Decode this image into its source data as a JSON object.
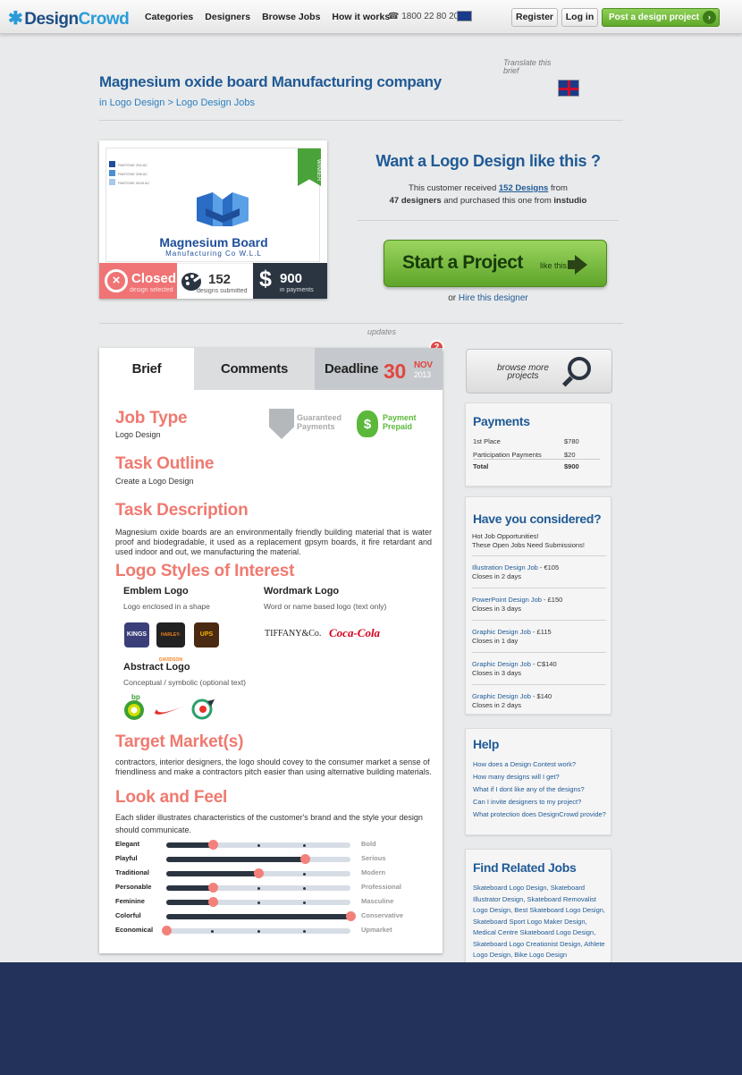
{
  "nav": {
    "brand_design": "Design",
    "brand_crowd": "Crowd",
    "links": [
      "Categories",
      "Designers",
      "Browse Jobs",
      "How it works"
    ],
    "phone": "1800 22 80 20",
    "register": "Register",
    "login": "Log in",
    "post": "Post a design project"
  },
  "header": {
    "title": "Magnesium oxide board Manufacturing company",
    "breadcrumb": "in Logo Design > Logo Design Jobs",
    "translate": "Translate this brief"
  },
  "winner_card": {
    "swatches": [
      "PANTONE 294 AC",
      "PANTONE 298 AC",
      "PANTONE 5445 AC"
    ],
    "logo_name": "Magnesium Board",
    "logo_sub": "Manufacturing Co W.L.L",
    "ribbon": "WINNER",
    "closed": "Closed",
    "closed_sub": "design selected",
    "designs_count": "152",
    "designs_sub": "designs submitted",
    "payments": "900",
    "payments_sub": "in payments"
  },
  "cta": {
    "title": "Want a Logo Design like this ?",
    "line1_a": "This customer received ",
    "line1_link": "152 Designs",
    "line1_b": " from",
    "line2_a": "47 designers",
    "line2_b": " and purchased this one from ",
    "line2_c": "instudio",
    "start": "Start a Project",
    "start_like": "like this",
    "hire_or": "or ",
    "hire_link": "Hire this designer"
  },
  "tabs": {
    "updates": "updates",
    "badge": "2",
    "brief": "Brief",
    "comments": "Comments",
    "deadline": "Deadline",
    "day": "30",
    "month": "NOV",
    "year": "2013"
  },
  "brief": {
    "job_type_h": "Job Type",
    "job_type": "Logo Design",
    "guaranteed": "Guaranteed Payments",
    "prepaid": "Payment Prepaid",
    "outline_h": "Task Outline",
    "outline": "Create a Logo Design",
    "desc_h": "Task Description",
    "desc": "Magnesium oxide boards are an environmentally friendly building material that is water proof and biodegradable, it used as a replacement gpsym boards, it fire retardant and used indoor and out, we manufacturing the material.",
    "styles_h": "Logo Styles of Interest",
    "styles": [
      {
        "name": "Emblem Logo",
        "desc": "Logo enclosed in a shape"
      },
      {
        "name": "Wordmark Logo",
        "desc": "Word or name based logo (text only)"
      },
      {
        "name": "Abstract Logo",
        "desc": "Conceptual / symbolic (optional text)"
      }
    ],
    "example_logos": [
      "KINGS",
      "HARLEY-DAVIDSON",
      "UPS",
      "TIFFANY&Co.",
      "Coca-Cola",
      "bp"
    ],
    "market_h": "Target Market(s)",
    "market": "contractors, interior designers, the logo should covey to the consumer market a sense of friendliness and make a contractors pitch easier than using alternative building materials.",
    "look_h": "Look and Feel",
    "look": "Each slider illustrates characteristics of the customer's brand and the style your design should communicate.",
    "sliders": [
      {
        "left": "Elegant",
        "right": "Bold",
        "level": 0.25
      },
      {
        "left": "Playful",
        "right": "Serious",
        "level": 0.75
      },
      {
        "left": "Traditional",
        "right": "Modern",
        "level": 0.5
      },
      {
        "left": "Personable",
        "right": "Professional",
        "level": 0.25
      },
      {
        "left": "Feminine",
        "right": "Masculine",
        "level": 0.25
      },
      {
        "left": "Colorful",
        "right": "Conservative",
        "level": 1.0
      },
      {
        "left": "Economical",
        "right": "Upmarket",
        "level": 0.0
      }
    ]
  },
  "sidebar": {
    "browse": "browse more projects",
    "payments_h": "Payments",
    "payments": [
      {
        "label": "1st Place",
        "value": "$780"
      },
      {
        "label": "Participation Payments",
        "value": "$20"
      },
      {
        "label": "Total",
        "value": "$900"
      }
    ],
    "considered_h": "Have you considered?",
    "considered_intro1": "Hot Job Opportunities!",
    "considered_intro2": "These Open Jobs Need Submissions!",
    "jobs": [
      {
        "link": "Illustration Design Job",
        "price": " - €105",
        "closes": "Closes in 2 days"
      },
      {
        "link": "PowerPoint Design Job",
        "price": " - £150",
        "closes": "Closes in 3 days"
      },
      {
        "link": "Graphic Design Job",
        "price": " - £115",
        "closes": "Closes in 1 day"
      },
      {
        "link": "Graphic Design Job",
        "price": " - C$140",
        "closes": "Closes in 3 days"
      },
      {
        "link": "Graphic Design Job",
        "price": " - $140",
        "closes": "Closes in 2 days"
      }
    ],
    "help_h": "Help",
    "help": [
      "How does a Design Contest work?",
      "How many designs will I get?",
      "What if I dont like any of the designs?",
      "Can I invite designers to my project?",
      "What protection does DesignCrowd provide?"
    ],
    "related_h": "Find Related Jobs",
    "related": "Skateboard Logo Design, Skateboard Illustrator Design, Skateboard Removalist Logo Design, Best Skateboard Logo Design, Skateboard Sport Logo Maker Design, Medical Centre Skateboard Logo Design, Skateboard Logo Creationist Design, Athlete Logo Design, Bike Logo Design"
  }
}
